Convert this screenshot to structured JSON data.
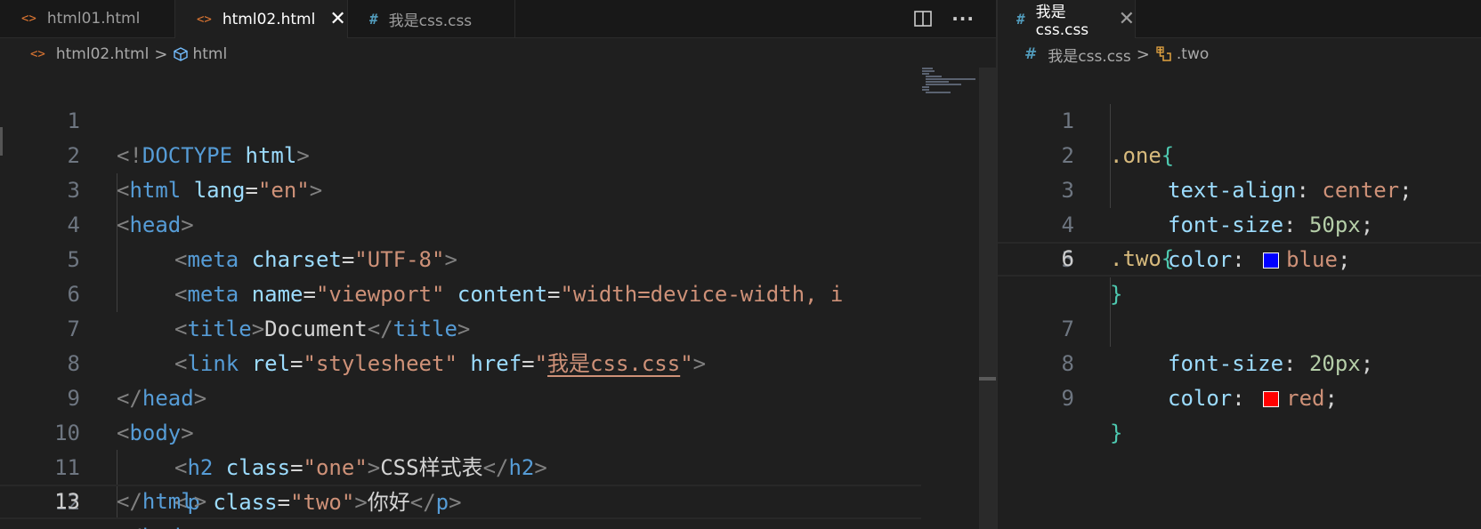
{
  "left": {
    "tabs": [
      {
        "icon": "<>",
        "label": "html01.html"
      },
      {
        "icon": "<>",
        "label": "html02.html",
        "close": "✕"
      },
      {
        "icon": "#",
        "label": "我是css.css"
      }
    ],
    "more": "···",
    "breadcrumb": {
      "file": "html02.html",
      "symbol": "html",
      "sep": ">"
    },
    "line_numbers": [
      "1",
      "2",
      "3",
      "4",
      "5",
      "6",
      "7",
      "8",
      "9",
      "10",
      "11",
      "12",
      "13"
    ],
    "code": {
      "l1": {
        "open": "<!",
        "doctype": "DOCTYPE",
        "sp": " ",
        "html": "html",
        "close": ">"
      },
      "l2": {
        "open": "<",
        "tag": "html",
        "attr": " lang",
        "eq": "=",
        "val": "\"en\"",
        "close": ">"
      },
      "l3": {
        "open": "<",
        "tag": "head",
        "close": ">"
      },
      "l4": {
        "open": "<",
        "tag": "meta",
        "attr": " charset",
        "eq": "=",
        "val": "\"UTF-8\"",
        "close": ">"
      },
      "l5": {
        "open": "<",
        "tag": "meta",
        "attr1": " name",
        "eq1": "=",
        "val1": "\"viewport\"",
        "attr2": " content",
        "eq2": "=",
        "val2": "\"width=device-width, i"
      },
      "l6": {
        "open": "<",
        "tag": "title",
        "close": ">",
        "text": "Document",
        "open2": "</",
        "tag2": "title",
        "close2": ">"
      },
      "l7": {
        "open": "<",
        "tag": "link",
        "attr1": " rel",
        "eq1": "=",
        "val1": "\"stylesheet\"",
        "attr2": " href",
        "eq2": "=",
        "q1": "\"",
        "href": "我是css.css",
        "q2": "\"",
        "close": ">"
      },
      "l8": {
        "open": "</",
        "tag": "head",
        "close": ">"
      },
      "l9": {
        "open": "<",
        "tag": "body",
        "close": ">"
      },
      "l10": {
        "open": "<",
        "tag": "h2",
        "attr": " class",
        "eq": "=",
        "val": "\"one\"",
        "close": ">",
        "text": "CSS样式表",
        "open2": "</",
        "tag2": "h2",
        "close2": ">"
      },
      "l11": {
        "open": "<",
        "tag": "p",
        "attr": " class",
        "eq": "=",
        "val": "\"two\"",
        "close": ">",
        "text": "你好",
        "open2": "</",
        "tag2": "p",
        "close2": ">"
      },
      "l12": {
        "open": "</",
        "tag": "body",
        "close": ">"
      },
      "l13": {
        "open": "</",
        "tag": "html",
        "close": ">"
      }
    },
    "current_line": 13
  },
  "right": {
    "tab": {
      "icon": "#",
      "label": "我是css.css",
      "close": "✕"
    },
    "breadcrumb": {
      "file": "我是css.css",
      "symbol": ".two",
      "sep": ">"
    },
    "line_numbers": [
      "1",
      "2",
      "3",
      "4",
      "5",
      "6",
      "7",
      "8",
      "9"
    ],
    "code": {
      "l1": {
        "sel": ".one",
        "brace": "{"
      },
      "l2": {
        "prop": "text-align",
        "colon": ": ",
        "val": "center",
        "semi": ";"
      },
      "l3": {
        "prop": "font-size",
        "colon": ": ",
        "val": "50px",
        "semi": ";"
      },
      "l4": {
        "prop": "color",
        "colon": ": ",
        "val": "blue",
        "semi": ";"
      },
      "l5": {
        "brace": "}"
      },
      "l6": {
        "sel": ".two",
        "brace": "{"
      },
      "l7": {
        "prop": "font-size",
        "colon": ": ",
        "val": "20px",
        "semi": ";"
      },
      "l8": {
        "prop": "color",
        "colon": ": ",
        "val": "red",
        "semi": ";"
      },
      "l9": {
        "brace": "}"
      }
    },
    "current_line": 6,
    "swatch_colors": {
      "blue": "#0000ff",
      "red": "#ff0000"
    }
  },
  "colors": {
    "editor_bg": "#1f1f1f",
    "tabbar_bg": "#181818",
    "tag": "#569cd6",
    "attr": "#9cdcfe",
    "string": "#ce9178",
    "selector": "#d7ba7d",
    "brace": "#4ec9b0",
    "number": "#b5cea8"
  }
}
